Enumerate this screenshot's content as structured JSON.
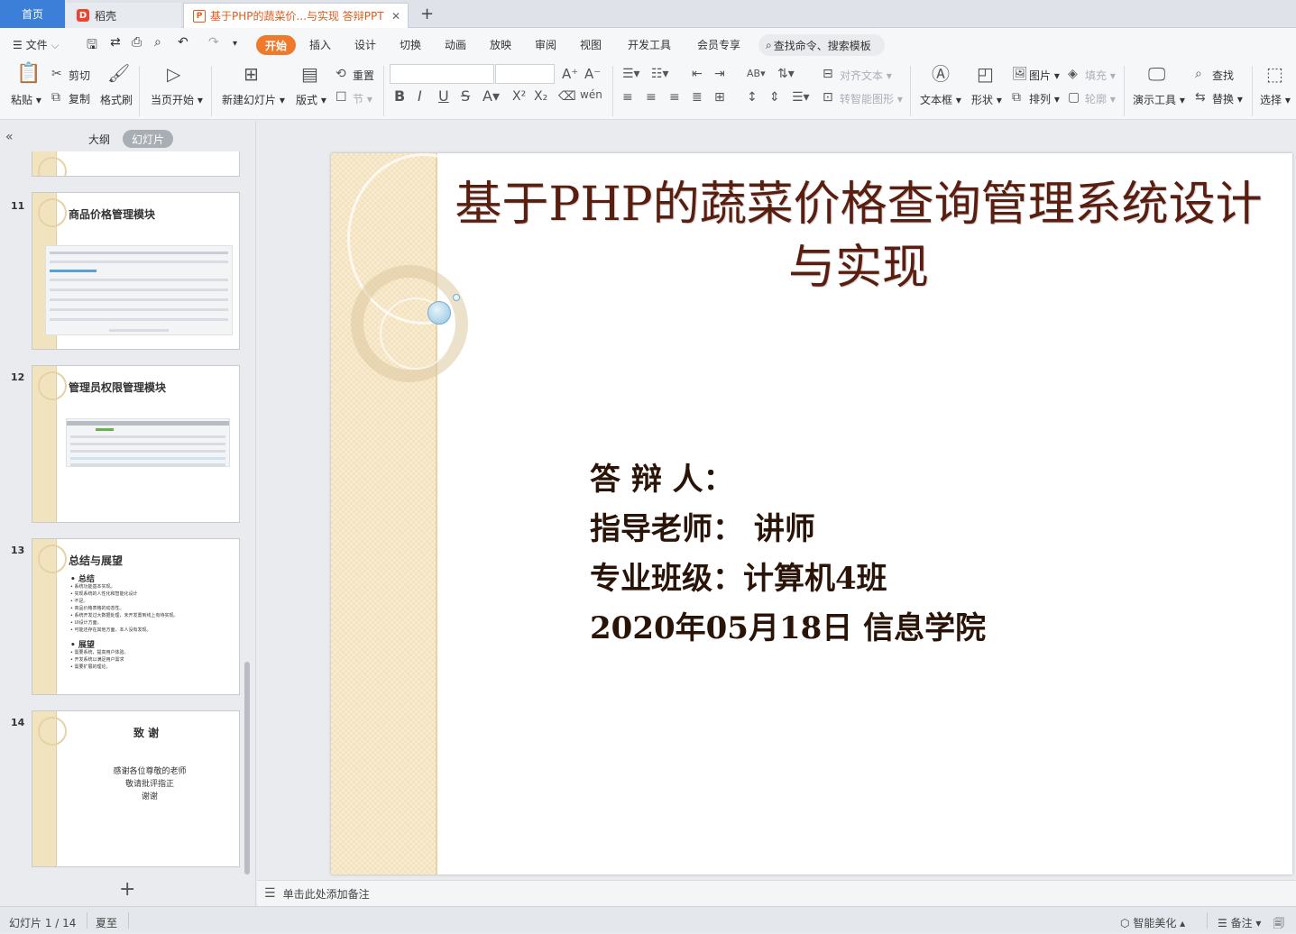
{
  "tabs": {
    "home": "首页",
    "daoke": "稻壳",
    "doc": "基于PHP的蔬菜价...与实现 答辩PPT",
    "close": "✕",
    "add": "+"
  },
  "menu": {
    "file": "文件",
    "items": [
      "开始",
      "插入",
      "设计",
      "切换",
      "动画",
      "放映",
      "审阅",
      "视图",
      "开发工具",
      "会员专享"
    ],
    "search": "查找命令、搜索模板"
  },
  "ribbon": {
    "paste": "粘贴",
    "cut": "剪切",
    "copy": "复制",
    "format_painter": "格式刷",
    "from_current": "当页开始",
    "new_slide": "新建幻灯片",
    "layout": "版式",
    "reset": "重置",
    "section": "节",
    "align_text": "对齐文本",
    "smart_art": "转智能图形",
    "textbox": "文本框",
    "shape": "形状",
    "picture": "图片",
    "arrange": "排列",
    "fill": "填充",
    "outline": "轮廓",
    "present_tools": "演示工具",
    "find": "查找",
    "replace": "替换",
    "select": "选择"
  },
  "left_panel": {
    "outline_tab": "大纲",
    "slides_tab": "幻灯片",
    "thumbnails": [
      {
        "num": "11",
        "title": "商品价格管理模块"
      },
      {
        "num": "12",
        "title": "管理员权限管理模块"
      },
      {
        "num": "13",
        "title": "总结与展望",
        "sec1": "总结",
        "lines1": [
          "系统功能基本实现。",
          "实现系统的人性化和智能化设计",
          "不足。",
          "商品价格表格的动态性。",
          "系统开发过大数据处理，未开发置到线上有待实现。",
          "UI设计方面。",
          "可能还存在其他方面，本人没有发现。"
        ],
        "sec2": "展望",
        "lines2": [
          "需要系统，提高用户体验。",
          "开发系统以满足用户需求",
          "需要扩展的理论。"
        ]
      },
      {
        "num": "14",
        "title": "致  谢",
        "lines": [
          "感谢各位尊敬的老师",
          "敬请批评指正",
          "谢谢"
        ]
      }
    ]
  },
  "slide": {
    "title_line1": "基于PHP的蔬菜价格查询管理系统设计",
    "title_line2": "与实现",
    "line1": "答  辩  人：",
    "line2": "指导老师：      讲师",
    "line3": "专业班级：计算机4班",
    "line4": "2020年05月18日      信息学院"
  },
  "notes": {
    "placeholder": "单击此处添加备注"
  },
  "status": {
    "slide_count": "幻灯片 1 / 14",
    "theme": "夏至",
    "smart_beautify": "智能美化",
    "notes": "备注"
  }
}
